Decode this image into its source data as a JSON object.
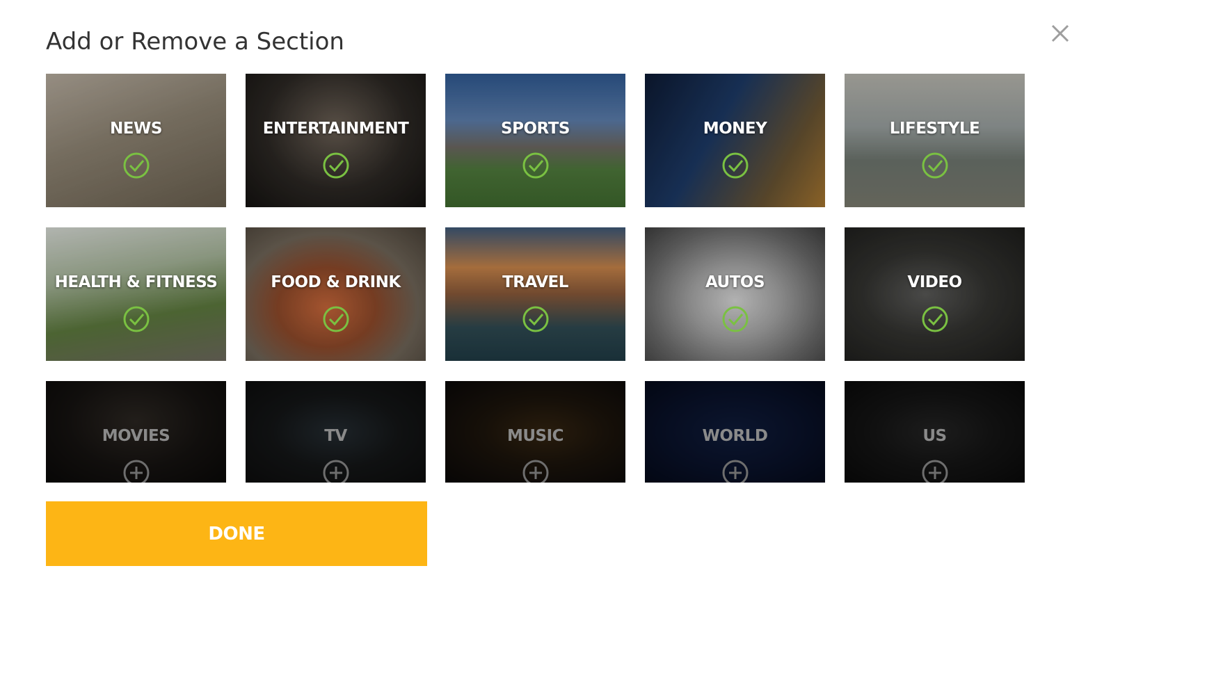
{
  "dialog": {
    "title": "Add or Remove a Section",
    "close_icon": "close-icon",
    "done_label": "DONE"
  },
  "colors": {
    "accent_done": "#fdb515",
    "check_green": "#7ac142",
    "title_text": "#333333",
    "close_icon": "#9e9e9e"
  },
  "sections": [
    {
      "label": "NEWS",
      "selected": true,
      "icon": "check-circle-icon"
    },
    {
      "label": "ENTERTAINMENT",
      "selected": true,
      "icon": "check-circle-icon"
    },
    {
      "label": "SPORTS",
      "selected": true,
      "icon": "check-circle-icon"
    },
    {
      "label": "MONEY",
      "selected": true,
      "icon": "check-circle-icon"
    },
    {
      "label": "LIFESTYLE",
      "selected": true,
      "icon": "check-circle-icon"
    },
    {
      "label": "HEALTH & FITNESS",
      "selected": true,
      "icon": "check-circle-icon"
    },
    {
      "label": "FOOD & DRINK",
      "selected": true,
      "icon": "check-circle-icon"
    },
    {
      "label": "TRAVEL",
      "selected": true,
      "icon": "check-circle-icon"
    },
    {
      "label": "AUTOS",
      "selected": true,
      "icon": "check-circle-icon"
    },
    {
      "label": "VIDEO",
      "selected": true,
      "icon": "check-circle-icon"
    },
    {
      "label": "MOVIES",
      "selected": false,
      "icon": "plus-circle-icon"
    },
    {
      "label": "TV",
      "selected": false,
      "icon": "plus-circle-icon"
    },
    {
      "label": "MUSIC",
      "selected": false,
      "icon": "plus-circle-icon"
    },
    {
      "label": "WORLD",
      "selected": false,
      "icon": "plus-circle-icon"
    },
    {
      "label": "US",
      "selected": false,
      "icon": "plus-circle-icon"
    }
  ]
}
